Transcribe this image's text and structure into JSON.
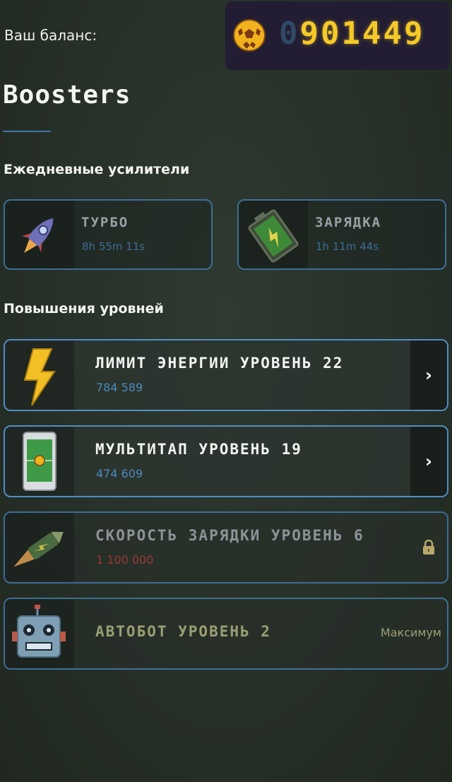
{
  "header": {
    "balance_label": "Ваш баланс:",
    "balance_dim_digit": "0",
    "balance_lit_digits": "901449",
    "coin_icon": "soccer-ball-icon"
  },
  "page": {
    "title": "Boosters"
  },
  "daily": {
    "section_title": "Ежедневные усилители",
    "items": [
      {
        "name": "ТУРБО",
        "timer": "8h 55m 11s",
        "icon": "rocket-icon"
      },
      {
        "name": "ЗАРЯДКА",
        "timer": "1h 11m 44s",
        "icon": "battery-icon"
      }
    ]
  },
  "upgrades": {
    "section_title": "Повышения уровней",
    "items": [
      {
        "name": "ЛИМИТ ЭНЕРГИИ УРОВЕНЬ 22",
        "price": "784 589",
        "icon": "lightning-icon",
        "state": "available"
      },
      {
        "name": "МУЛЬТИТАП УРОВЕНЬ 19",
        "price": "474 609",
        "icon": "phone-icon",
        "state": "available"
      },
      {
        "name": "СКОРОСТЬ ЗАРЯДКИ УРОВЕНЬ 6",
        "price": "1 100 000",
        "icon": "charging-rocket-icon",
        "state": "locked"
      },
      {
        "name": "АВТОБОТ УРОВЕНЬ 2",
        "status": "Максимум",
        "icon": "robot-icon",
        "state": "max"
      }
    ]
  },
  "colors": {
    "accent_blue": "#4f8fc4",
    "coin_digits": "#f5c928",
    "locked_price": "#9b3b33"
  }
}
